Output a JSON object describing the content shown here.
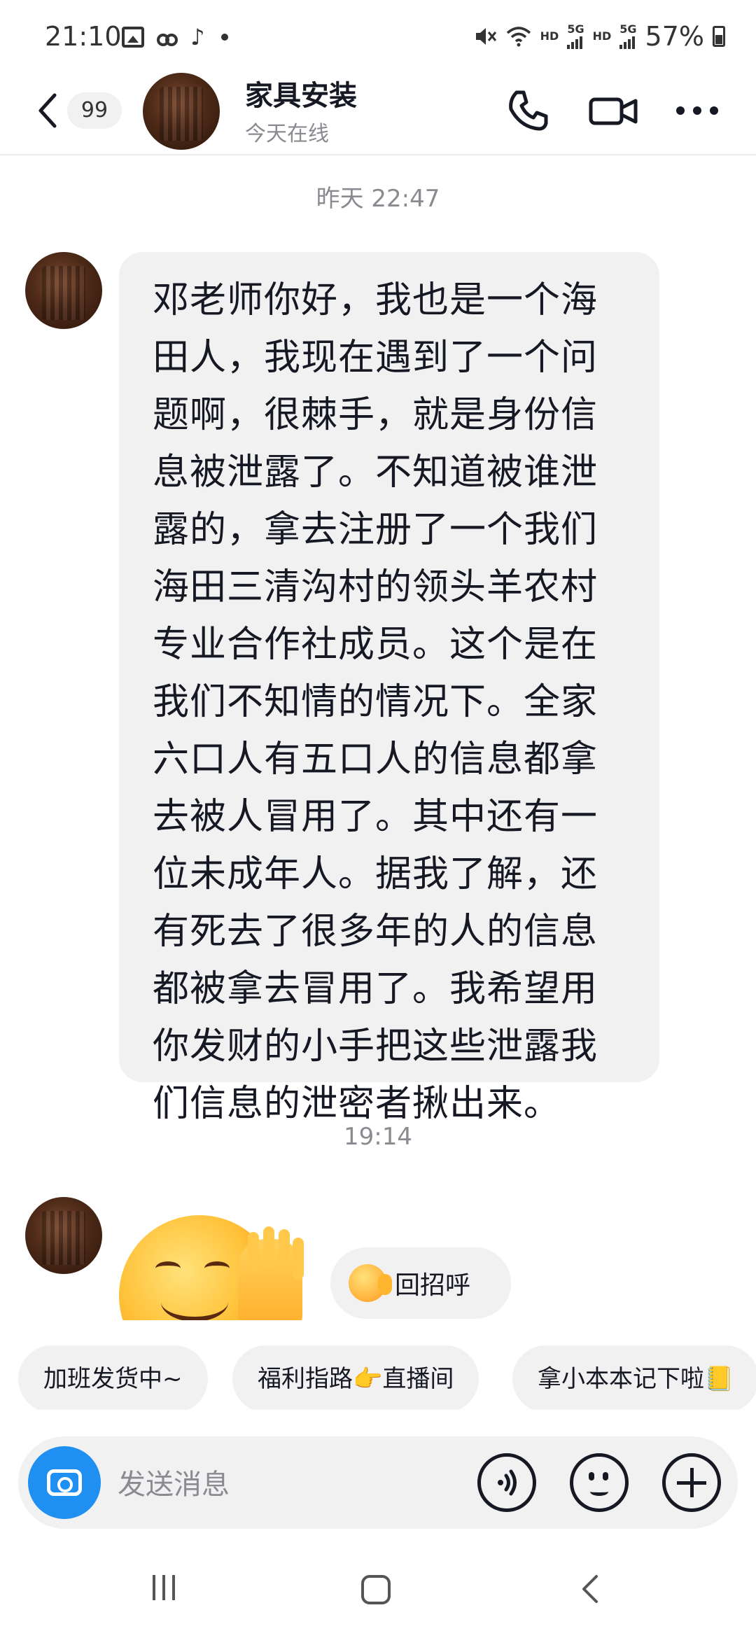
{
  "status_bar": {
    "time": "21:10",
    "hd1": "HD",
    "net1": "5G",
    "hd2": "HD",
    "net2": "5G",
    "battery": "57%"
  },
  "header": {
    "unread_count": "99",
    "contact_name": "家具安装",
    "contact_status": "今天在线"
  },
  "messages": [
    {
      "timestamp": "昨天 22:47",
      "text": "邓老师你好，我也是一个海田人，我现在遇到了一个问题啊，很棘手，就是身份信息被泄露了。不知道被谁泄露的，拿去注册了一个我们海田三清沟村的领头羊农村专业合作社成员。这个是在我们不知情的情况下。全家六口人有五口人的信息都拿去被人冒用了。其中还有一位未成年人。据我了解，还有死去了很多年的人的信息都被拿去冒用了。我希望用你发财的小手把这些泄露我们信息的泄密者揪出来。"
    },
    {
      "timestamp": "19:14",
      "greeting_chip": "回招呼"
    }
  ],
  "quick_replies": [
    "加班发货中~",
    "福利指路👉直播间",
    "拿小本本记下啦📒"
  ],
  "input": {
    "placeholder": "发送消息"
  },
  "colors": {
    "accent_blue": "#1f8ff2",
    "bubble_bg": "#f1f1f2",
    "muted_text": "#8a8b91"
  }
}
